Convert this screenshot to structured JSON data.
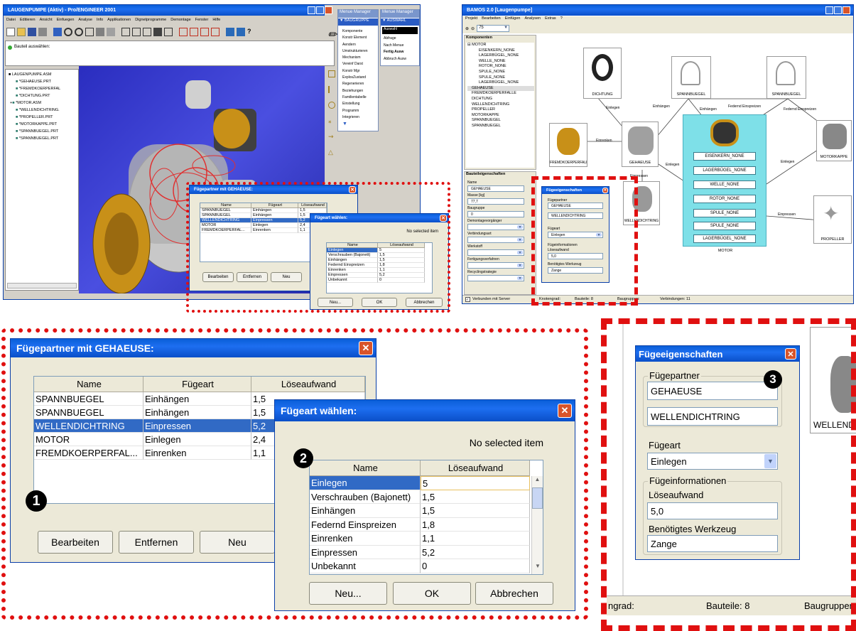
{
  "proe": {
    "title": "LAUGENPUMPE (Aktiv) - Pro/ENGINEER 2001",
    "menu": [
      "Datei",
      "Editieren",
      "Ansicht",
      "Einfuegen",
      "Analyse",
      "Info",
      "Applikationen",
      "Dignetprogramme",
      "Demontage",
      "Fenster",
      "Hilfe"
    ],
    "select_prompt": "Bauteil auswählen:",
    "tree": [
      "LAUGENPUMPE.ASM",
      "*GEHAEUSE.PRT",
      "*FREMDKOERPERFAL",
      "*DICHTUNG.PRT",
      "*MOTOR.ASM",
      "*WELLENDICHTRING.",
      "*PROPELLER.PRT",
      "*MOTORKAPPE.PRT",
      "*SPANNBUEGEL.PRT",
      "*SPANNBUEGEL.PRT"
    ],
    "menu_manager_title": "Menue Manager",
    "baugruppe_header": "BAUGRUPPE",
    "baugruppe_items": [
      "Komponente",
      "Konstr Element",
      "Aendern",
      "Umstrukturieren",
      "Mechanism",
      "Vereinf Darst",
      "Konstr Mgr",
      "ExplosZustand",
      "Regenerieren",
      "Beziehungen",
      "Familientabelle",
      "Einstellung",
      "Programm",
      "Integrieren"
    ],
    "auswahl_header": "AUSWAHL",
    "auswahl_items": [
      "Auswahl",
      "Abfrage",
      "Nach Menue",
      "Fertig Ausw",
      "Abbruch Ausw"
    ]
  },
  "fuegepartner": {
    "title": "Fügepartner mit GEHAEUSE:",
    "columns": [
      "Name",
      "Fügeart",
      "Löseaufwand"
    ],
    "rows": [
      [
        "SPANNBUEGEL",
        "Einhängen",
        "1,5"
      ],
      [
        "SPANNBUEGEL",
        "Einhängen",
        "1,5"
      ],
      [
        "WELLENDICHTRING",
        "Einpressen",
        "5,2"
      ],
      [
        "MOTOR",
        "Einlegen",
        "2,4"
      ],
      [
        "FREMDKOERPERFAL...",
        "Einrenken",
        "1,1"
      ]
    ],
    "buttons": [
      "Bearbeiten",
      "Entfernen",
      "Neu"
    ]
  },
  "fuegeart": {
    "title": "Fügeart wählen:",
    "status": "No selected item",
    "columns": [
      "Name",
      "Löseaufwand"
    ],
    "rows": [
      [
        "Einlegen",
        "5"
      ],
      [
        "Verschrauben (Bajonett)",
        "1,5"
      ],
      [
        "Einhängen",
        "1,5"
      ],
      [
        "Federnd Einspreizen",
        "1,8"
      ],
      [
        "Einrenken",
        "1,1"
      ],
      [
        "Einpressen",
        "5,2"
      ],
      [
        "Unbekannt",
        "0"
      ]
    ],
    "buttons": [
      "Neu...",
      "OK",
      "Abbrechen"
    ]
  },
  "bamos": {
    "title": "BAMOS 2.0 [Laugenpumpe]",
    "menu": [
      "Projekt",
      "Bearbeiten",
      "Einfügen",
      "Analysen",
      "Extras",
      "?"
    ],
    "zoom": "75",
    "komponenten_label": "Komponenten",
    "tree": [
      "MOTOR",
      "EISENKERN_NONE",
      "LAGERBÜGEL_NONE",
      "WELLE_NONE",
      "ROTOR_NONE",
      "SPULE_NONE",
      "SPULE_NONE",
      "LAGERBÜGEL_NONE",
      "GEHAEUSE",
      "FREMDKOERPERFALLE",
      "DICHTUNG",
      "WELLENDICHTRING",
      "PROPELLER",
      "MOTORKAPPE",
      "SPANNBUEGEL",
      "SPANNBUEGEL"
    ],
    "props_label": "Bauteileigenschaften",
    "props": [
      {
        "label": "Name",
        "value": "GEHAEUSE"
      },
      {
        "label": "Masse [kg]",
        "value": "77,7"
      },
      {
        "label": "Baugruppe",
        "value": "0"
      },
      {
        "label": "Demontagevorgänger",
        "value": ""
      },
      {
        "label": "Verbindungsart",
        "value": ""
      },
      {
        "label": "Werkstoff",
        "value": ""
      },
      {
        "label": "Fertigungsverfahren",
        "value": ""
      },
      {
        "label": "Recyclingstrategie",
        "value": ""
      }
    ],
    "nodes": [
      "DICHTUNG",
      "SPANNBUEGEL",
      "SPANNBUEGEL",
      "FREMDKOERPERFALLE",
      "GEHAEUSE",
      "MOTORKAPPE",
      "WELLENDICHTRING",
      "PROPELLER"
    ],
    "motor_label": "MOTOR",
    "motor_parts": [
      "EISENKERN_NONE",
      "LAGERBÜGEL_NONE",
      "WELLE_NONE",
      "ROTOR_NONE",
      "SPULE_NONE",
      "SPULE_NONE",
      "LAGERBÜGEL_NONE"
    ],
    "edges": [
      "Einlegen",
      "Einhängen",
      "Einhängen",
      "Federnd Einspreizen",
      "Federnd Einspreizen",
      "Einrenken",
      "Einpressen",
      "Einlegen",
      "Einlegen",
      "Einpressen"
    ],
    "status_connected": "Verbunden mit Server",
    "status_grad": "Knotengrad:",
    "status_bauteile": "Bauteile: 8",
    "status_baugruppen": "Baugruppen:",
    "status_verbindungen": "Verbindungen: 11"
  },
  "fuegeeig": {
    "title": "Fügeeigenschaften",
    "partner_label": "Fügepartner",
    "partner1": "GEHAEUSE",
    "partner2": "WELLENDICHTRING",
    "art_label": "Fügeart",
    "art_value": "Einlegen",
    "info_label": "Fügeinformationen",
    "loese_label": "Löseaufwand",
    "loese_value": "5,0",
    "werkzeug_label": "Benötigtes Werkzeug",
    "werkzeug_value": "Zange",
    "bg_node": "WELLENDI",
    "status_grad": "ngrad:",
    "status_bauteile": "Bauteile: 8",
    "status_baugruppen": "Baugruppen:"
  },
  "markers": [
    "1",
    "2",
    "3"
  ]
}
